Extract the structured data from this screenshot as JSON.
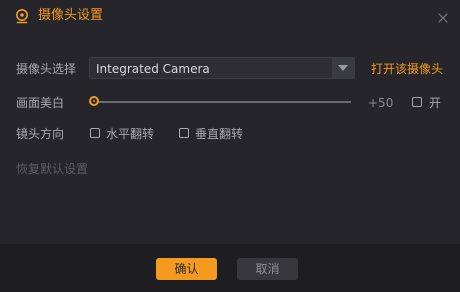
{
  "dialog": {
    "title": "摄像头设置",
    "accent_color": "#f39a1f",
    "title_icon": "webcam-icon",
    "close_icon": "close-icon"
  },
  "camera": {
    "label": "摄像头选择",
    "selected": "Integrated Camera",
    "open_link": "打开该摄像头"
  },
  "beauty": {
    "label": "画面美白",
    "slider_value": 0,
    "value_text": "+50",
    "toggle_label": "开",
    "toggle_checked": false
  },
  "mirror": {
    "label": "镜头方向",
    "horizontal_label": "水平翻转",
    "horizontal_checked": false,
    "vertical_label": "垂直翻转",
    "vertical_checked": false
  },
  "reset_label": "恢复默认设置",
  "footer": {
    "confirm_label": "确认",
    "cancel_label": "取消"
  }
}
